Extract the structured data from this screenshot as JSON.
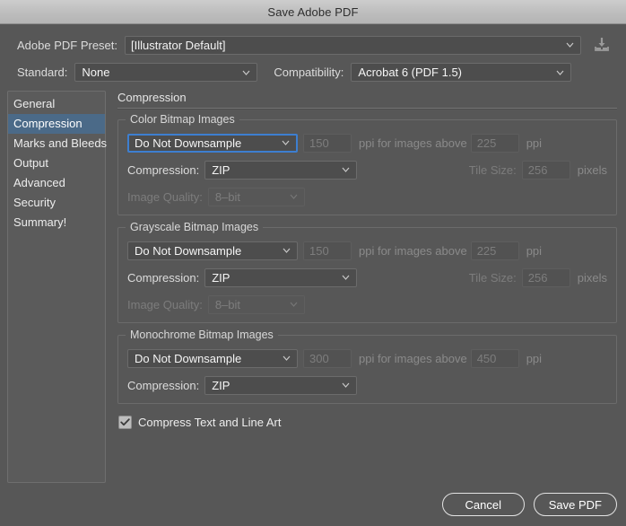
{
  "window": {
    "title": "Save Adobe PDF"
  },
  "top": {
    "preset_label": "Adobe PDF Preset:",
    "preset_value": "[Illustrator Default]",
    "save_preset_icon": "save-preset-icon",
    "standard_label": "Standard:",
    "standard_value": "None",
    "compatibility_label": "Compatibility:",
    "compatibility_value": "Acrobat 6 (PDF 1.5)"
  },
  "sidebar": {
    "items": [
      {
        "label": "General",
        "selected": false
      },
      {
        "label": "Compression",
        "selected": true
      },
      {
        "label": "Marks and Bleeds",
        "selected": false
      },
      {
        "label": "Output",
        "selected": false
      },
      {
        "label": "Advanced",
        "selected": false
      },
      {
        "label": "Security",
        "selected": false
      },
      {
        "label": "Summary!",
        "selected": false
      }
    ]
  },
  "panel": {
    "title": "Compression",
    "groups": {
      "color": {
        "legend": "Color Bitmap Images",
        "downsample_value": "Do Not Downsample",
        "ppi_value": "150",
        "ppi_mid_text": "ppi for images above",
        "threshold_value": "225",
        "ppi_unit": "ppi",
        "compression_label": "Compression:",
        "compression_value": "ZIP",
        "tile_label": "Tile Size:",
        "tile_value": "256",
        "tile_unit": "pixels",
        "quality_label": "Image Quality:",
        "quality_value": "8–bit"
      },
      "grayscale": {
        "legend": "Grayscale Bitmap Images",
        "downsample_value": "Do Not Downsample",
        "ppi_value": "150",
        "ppi_mid_text": "ppi for images above",
        "threshold_value": "225",
        "ppi_unit": "ppi",
        "compression_label": "Compression:",
        "compression_value": "ZIP",
        "tile_label": "Tile Size:",
        "tile_value": "256",
        "tile_unit": "pixels",
        "quality_label": "Image Quality:",
        "quality_value": "8–bit"
      },
      "monochrome": {
        "legend": "Monochrome Bitmap Images",
        "downsample_value": "Do Not Downsample",
        "ppi_value": "300",
        "ppi_mid_text": "ppi for images above",
        "threshold_value": "450",
        "ppi_unit": "ppi",
        "compression_label": "Compression:",
        "compression_value": "ZIP"
      }
    },
    "compress_text_label": "Compress Text and Line Art",
    "compress_text_checked": true
  },
  "footer": {
    "cancel_label": "Cancel",
    "save_label": "Save PDF"
  },
  "colors": {
    "window_bg": "#575757",
    "titlebar": "#bdbdbd",
    "accent_selected": "#4b6a88",
    "focus_blue": "#3d7fd0",
    "text": "#ededed",
    "disabled_text": "#7d7d7d"
  }
}
